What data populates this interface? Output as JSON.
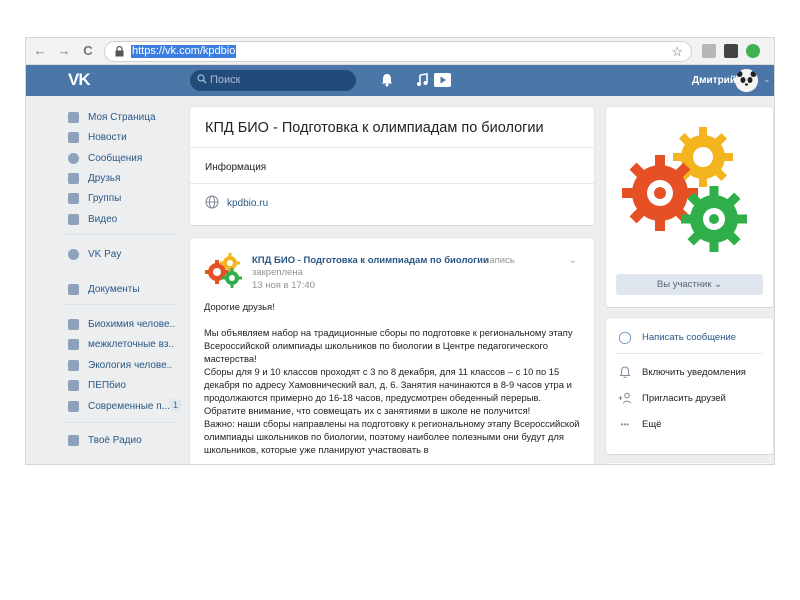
{
  "browser": {
    "url": "https://vk.com/kpdbio",
    "back_icon": "←",
    "forward_icon": "→",
    "reload_icon": "C",
    "star_icon": "☆"
  },
  "header": {
    "logo": "VK",
    "search_placeholder": "Поиск",
    "user_name": "Дмитрий",
    "chevron": "⌄"
  },
  "sidebar": {
    "items": [
      {
        "label": "Моя Страница",
        "icon": "home-icon"
      },
      {
        "label": "Новости",
        "icon": "news-icon"
      },
      {
        "label": "Сообщения",
        "icon": "messages-icon"
      },
      {
        "label": "Друзья",
        "icon": "friends-icon"
      },
      {
        "label": "Группы",
        "icon": "groups-icon"
      },
      {
        "label": "Видео",
        "icon": "video-icon"
      },
      {
        "label": "VK Pay",
        "icon": "vkpay-icon"
      },
      {
        "label": "Документы",
        "icon": "documents-icon"
      },
      {
        "label": "Биохимия челове..",
        "icon": "group-icon"
      },
      {
        "label": "межклеточные вз..",
        "icon": "group-icon"
      },
      {
        "label": "Экология челове..",
        "icon": "group-icon"
      },
      {
        "label": "ПЕПбио",
        "icon": "group-icon"
      },
      {
        "label": "Современные п...",
        "icon": "group-icon",
        "count": "1"
      },
      {
        "label": "Твоё Радио",
        "icon": "apps-icon"
      }
    ]
  },
  "group": {
    "title": "КПД БИО - Подготовка к олимпиадам по биологии",
    "info_label": "Информация",
    "site": "kpdbio.ru"
  },
  "post": {
    "author": "КПД БИО - Подготовка к олимпиадам по биологии",
    "pinned_a": "запись",
    "pinned_b": "закреплена",
    "date": "13 ноя в 17:40",
    "menu_icon": "⌄",
    "paragraphs": [
      "Дорогие друзья!",
      "Мы объявляем набор на традиционные сборы по подготовке к региональному этапу Всероссийской олимпиады школьников по биологии в Центре педагогического мастерства!\nСборы для 9 и 10 классов проходят с 3 по 8 декабря, для 11 классов – с 10 по 15 декабря по адресу Хамовнический вал, д. 6. Занятия начинаются в 8-9 часов утра и продолжаются примерно до 16-18 часов, предусмотрен обеденный перерыв.\nОбратите внимание, что совмещать их с занятиями в школе не получится!\nВажно: наши сборы направлены на подготовку к региональному этапу Всероссийской олимпиады школьников по биологии, поэтому наиболее полезными они будут для школьников, которые уже планируют участвовать в"
    ]
  },
  "right": {
    "member_button": "Вы участник ⌄",
    "actions": [
      {
        "label": "Написать сообщение",
        "icon": "message-bubble-icon",
        "glyph": "◯",
        "color": "#2a5885"
      },
      {
        "label": "Включить уведомления",
        "icon": "bell-icon",
        "glyph": "🔔",
        "color": "#222222"
      },
      {
        "label": "Пригласить друзей",
        "icon": "add-friend-icon",
        "glyph": "+",
        "color": "#222222"
      },
      {
        "label": "Ещё",
        "icon": "more-icon",
        "glyph": "•••",
        "color": "#222222"
      }
    ]
  },
  "colors": {
    "vk_blue": "#4a76a8",
    "link": "#2a5885",
    "page_bg": "#edeef0"
  }
}
